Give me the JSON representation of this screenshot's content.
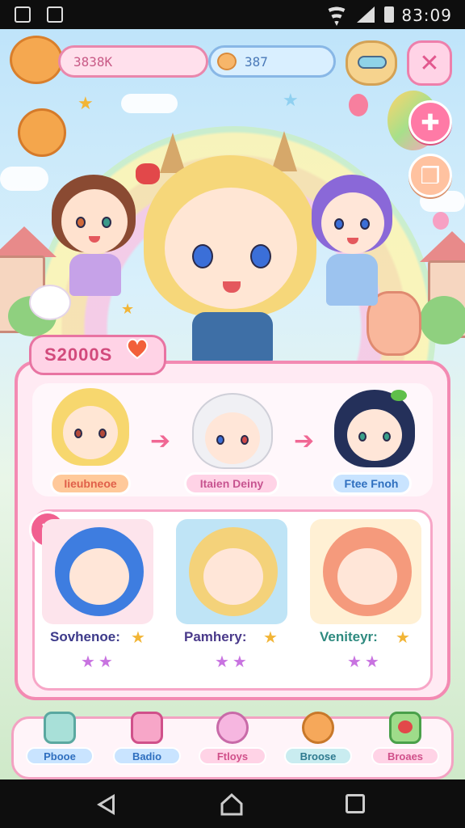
{
  "status_bar": {
    "time": "83:09"
  },
  "hud": {
    "coins": "3838K",
    "gems": "387",
    "close_symbol": "✕"
  },
  "side_buttons": {
    "heart_symbol": "✚",
    "book_symbol": "❐"
  },
  "score": {
    "value": "S2000S"
  },
  "evolution": {
    "stages": [
      {
        "name": "Iieubneoe",
        "color": "#f07b46"
      },
      {
        "name": "Itaien Deiny",
        "color": "#d86a9c"
      },
      {
        "name": "Ftee Fnoh",
        "color": "#3a74cf"
      }
    ]
  },
  "roster": {
    "close_symbol": "✕",
    "cards": [
      {
        "name": "Sovhenoe:",
        "stars": "★★",
        "badge": "★",
        "color": "#3d3a8a"
      },
      {
        "name": "Pamhery:",
        "stars": "★★",
        "badge": "★",
        "color": "#4a3a8a"
      },
      {
        "name": "Veniteyr:",
        "stars": "★★",
        "badge": "★",
        "color": "#2e8a7f"
      }
    ]
  },
  "bottom_nav": [
    {
      "label": "Pbooe",
      "color": "#2f6fbf"
    },
    {
      "label": "Badio",
      "color": "#2f6fbf"
    },
    {
      "label": "Ftloys",
      "color": "#d0508a"
    },
    {
      "label": "Broose",
      "color": "#2f7a8f"
    },
    {
      "label": "Broaes",
      "color": "#d0508a"
    }
  ],
  "colors": {
    "accent_pink": "#f38ab2",
    "panel_bg": "#ffeaf3",
    "star_gold": "#f2b536"
  }
}
